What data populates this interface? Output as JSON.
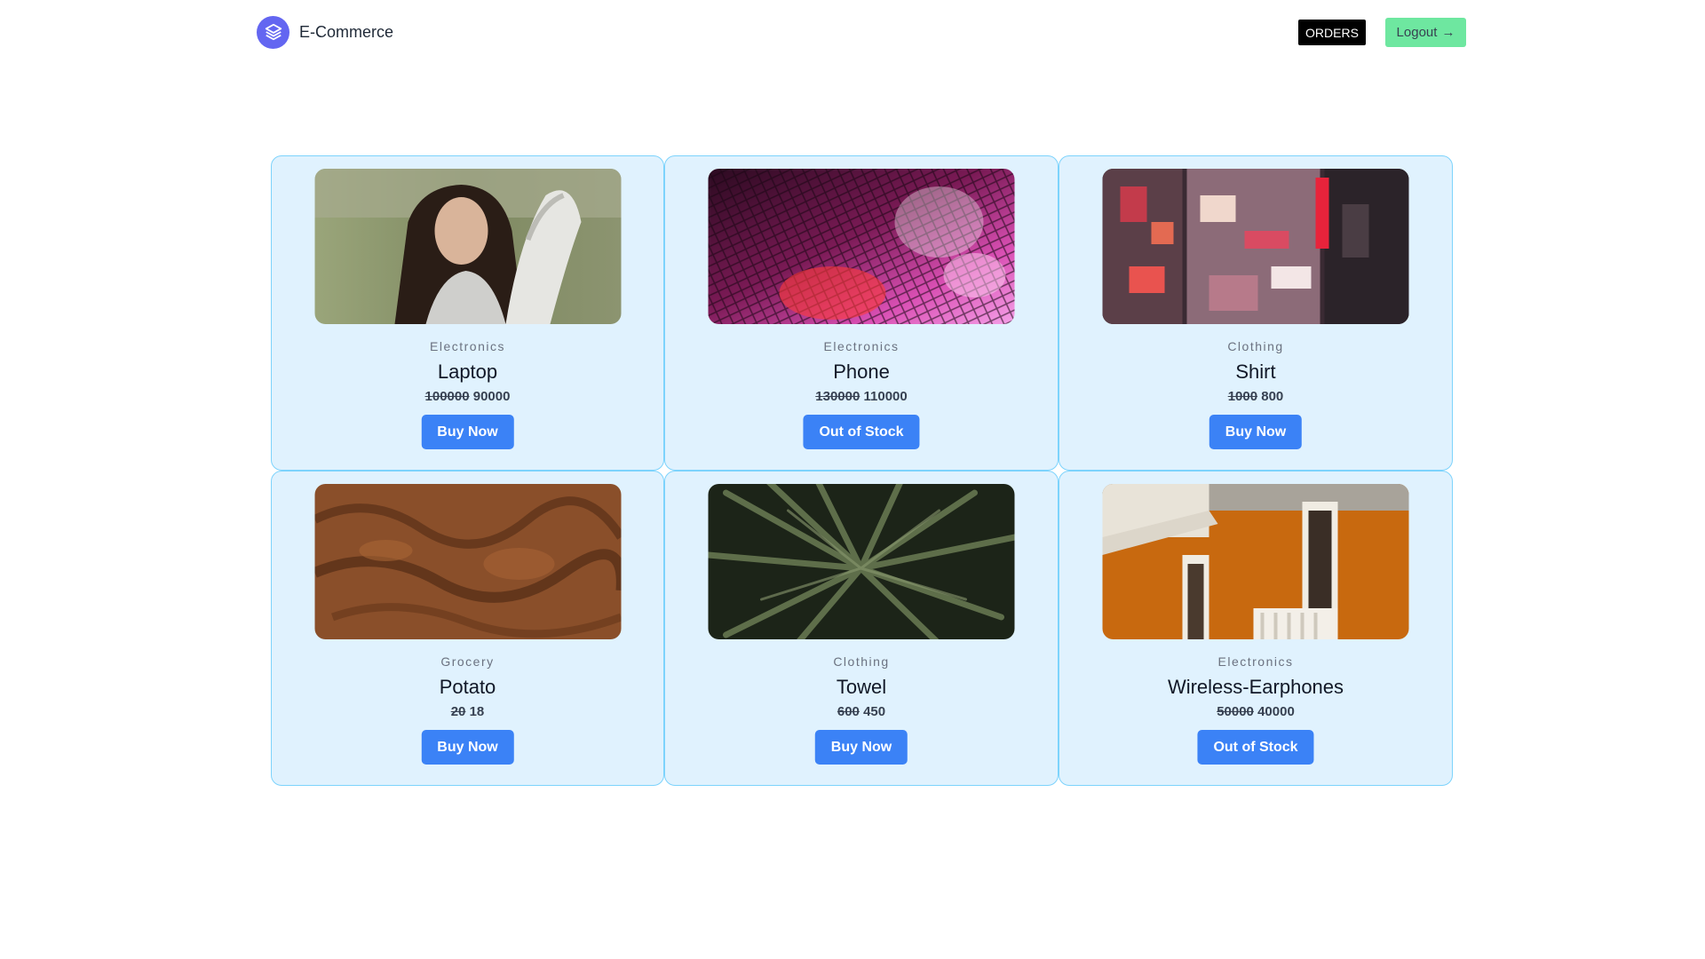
{
  "header": {
    "brand_name": "E-Commerce",
    "orders_label": "ORDERS",
    "logout_label": "Logout",
    "logout_arrow": "→",
    "logout_color": "#6ee7a0"
  },
  "products": [
    {
      "category": "Electronics",
      "name": "Laptop",
      "old_price": "100000",
      "price": "90000",
      "button": "Buy Now",
      "image": "portrait-woman-photo"
    },
    {
      "category": "Electronics",
      "name": "Phone",
      "old_price": "130000",
      "price": "110000",
      "button": "Out of Stock",
      "image": "disco-ball-photo"
    },
    {
      "category": "Clothing",
      "name": "Shirt",
      "old_price": "1000",
      "price": "800",
      "button": "Buy Now",
      "image": "city-street-signs-photo"
    },
    {
      "category": "Grocery",
      "name": "Potato",
      "old_price": "20",
      "price": "18",
      "button": "Buy Now",
      "image": "brown-texture-photo"
    },
    {
      "category": "Clothing",
      "name": "Towel",
      "old_price": "600",
      "price": "450",
      "button": "Buy Now",
      "image": "palm-leaves-photo"
    },
    {
      "category": "Electronics",
      "name": "Wireless-Earphones",
      "old_price": "50000",
      "price": "40000",
      "button": "Out of Stock",
      "image": "orange-building-photo"
    }
  ],
  "colors": {
    "card_bg": "#e0f2fe",
    "card_border": "#7dd3fc",
    "button_bg": "#3b82f6",
    "brand_logo": "#6366f1"
  }
}
